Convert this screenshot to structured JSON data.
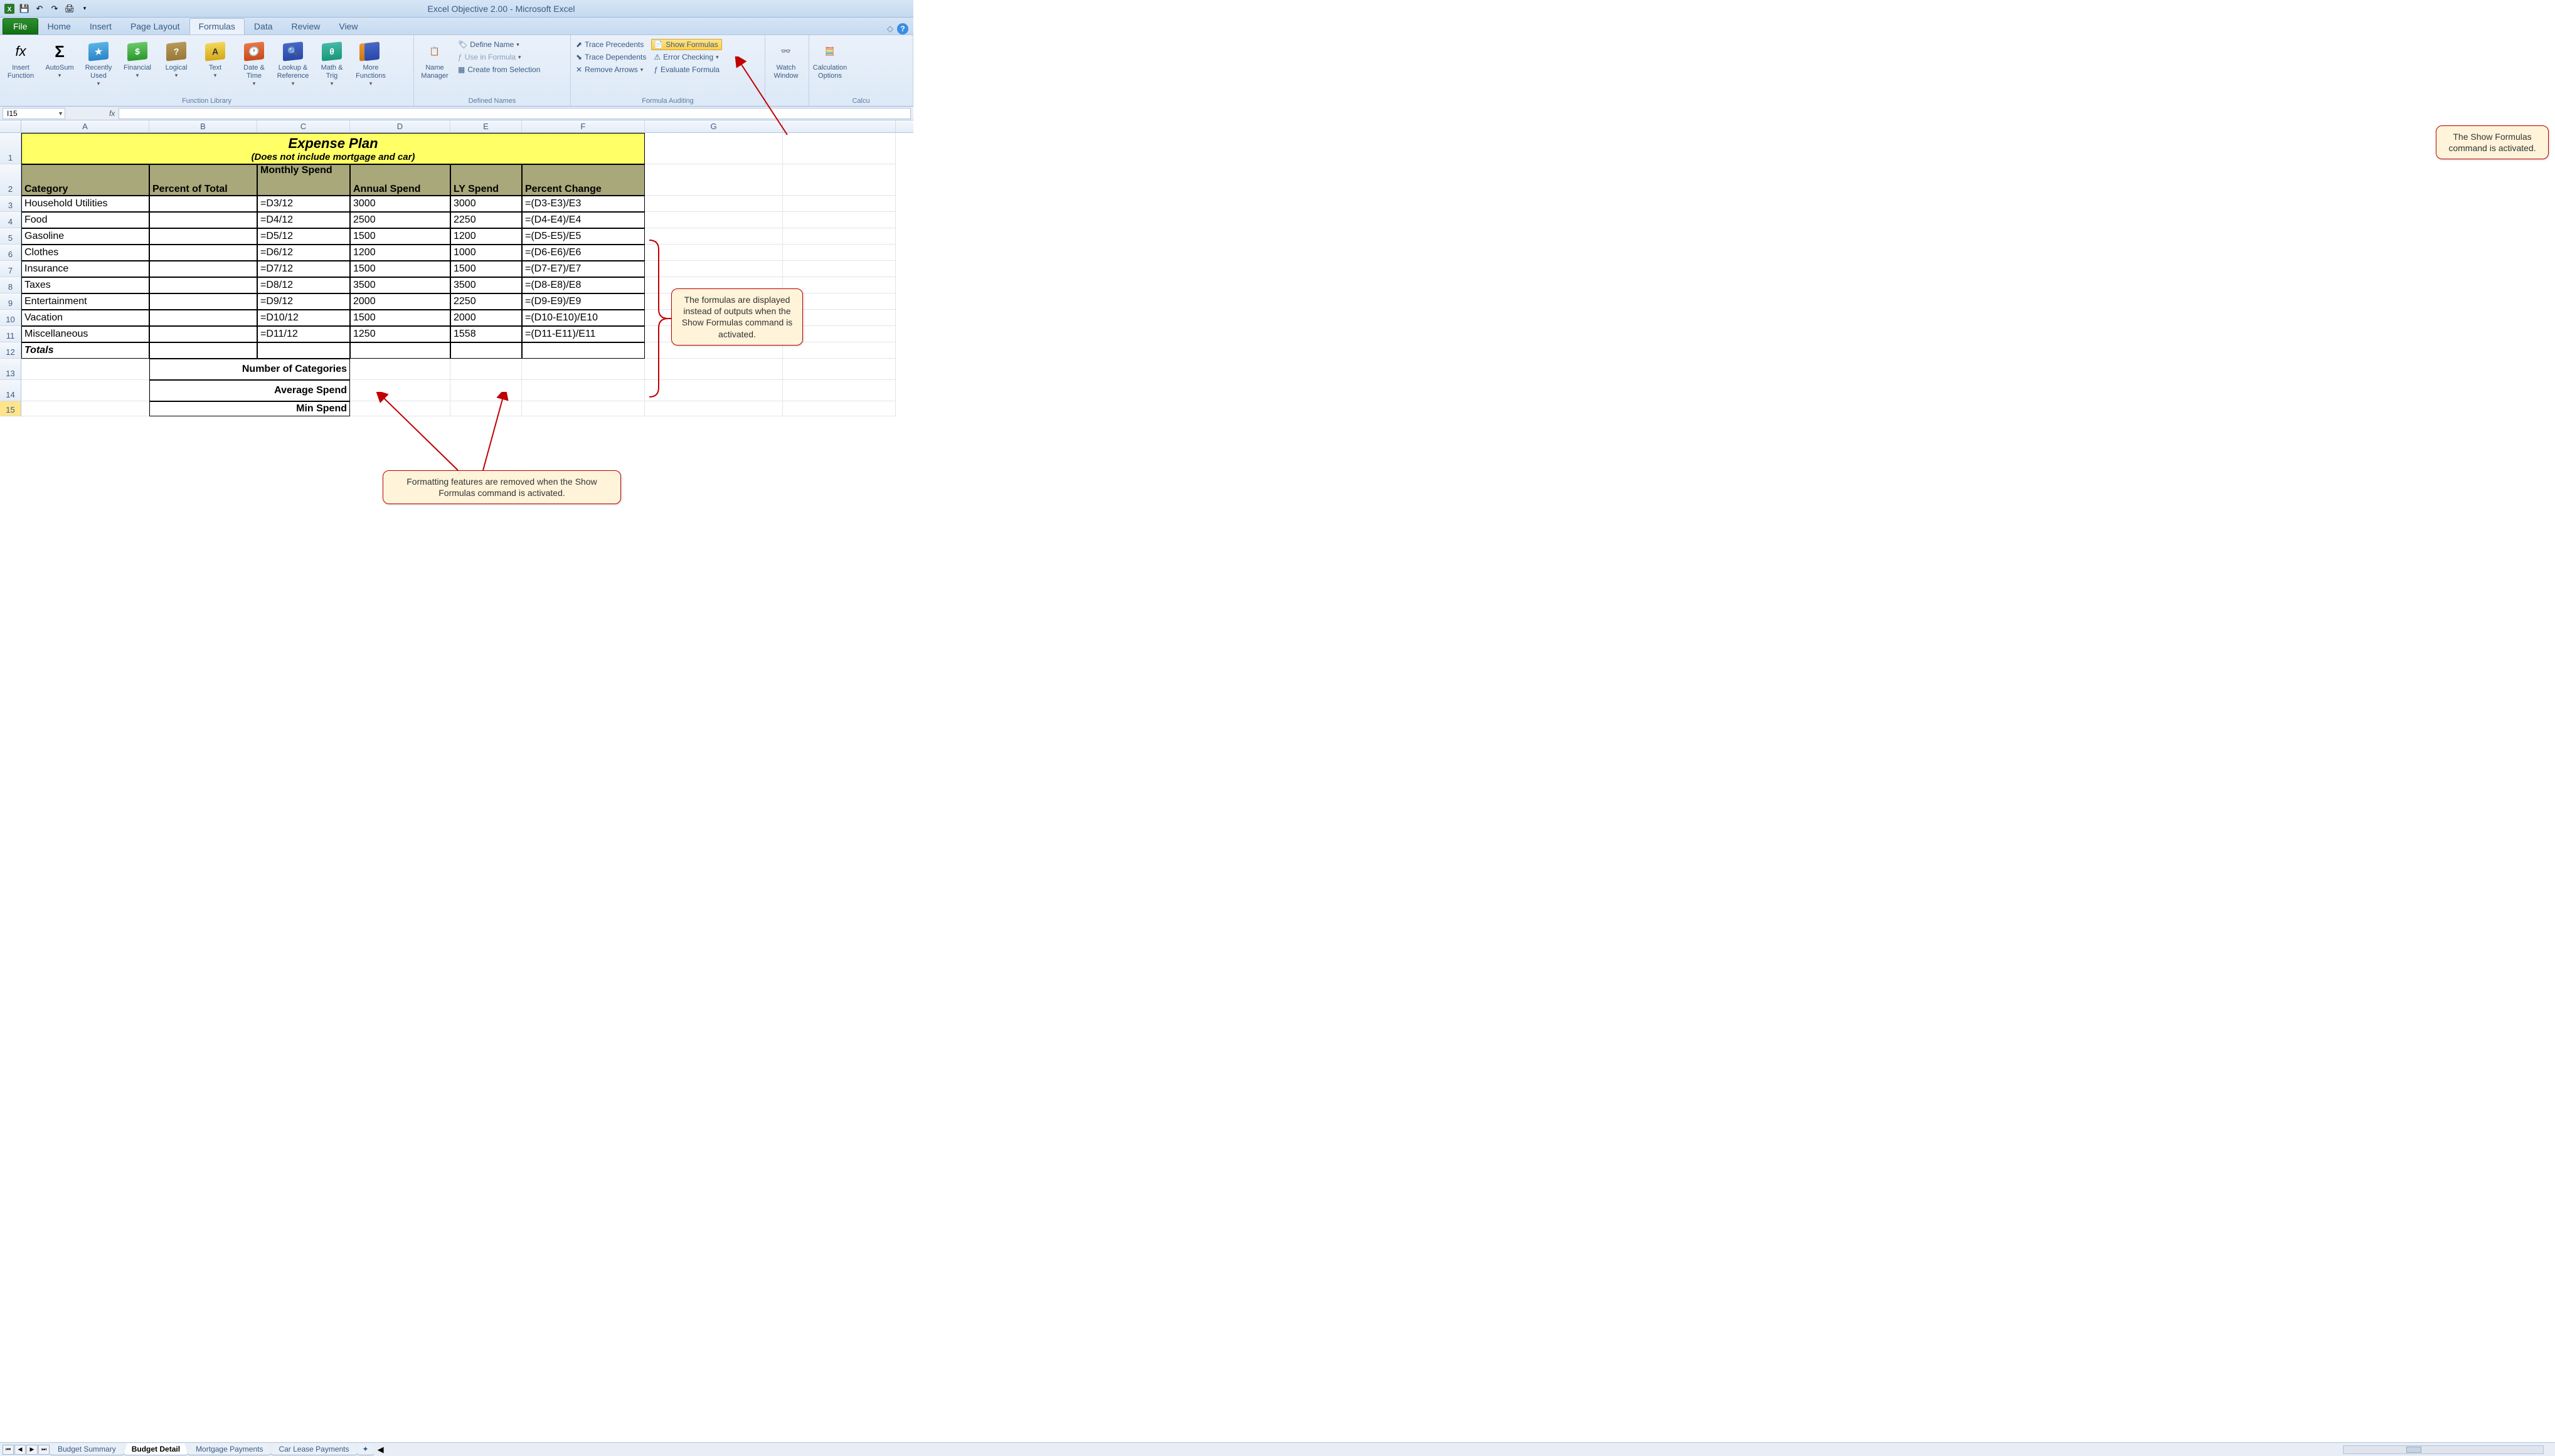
{
  "app": {
    "title_doc": "Excel Objective 2.00",
    "title_app": "Microsoft Excel"
  },
  "qat": {
    "save": "💾",
    "undo": "↶",
    "redo": "↷",
    "print": "🖨"
  },
  "tabs": [
    "File",
    "Home",
    "Insert",
    "Page Layout",
    "Formulas",
    "Data",
    "Review",
    "View"
  ],
  "active_tab": "Formulas",
  "ribbon": {
    "insert_function": "Insert Function",
    "autosum": "AutoSum",
    "recently_used": "Recently Used",
    "financial": "Financial",
    "logical": "Logical",
    "text": "Text",
    "date_time": "Date & Time",
    "lookup_ref": "Lookup & Reference",
    "math_trig": "Math & Trig",
    "more_functions": "More Functions",
    "group_function_library": "Function Library",
    "name_manager": "Name Manager",
    "define_name": "Define Name",
    "use_in_formula": "Use in Formula",
    "create_from_selection": "Create from Selection",
    "group_defined_names": "Defined Names",
    "trace_precedents": "Trace Precedents",
    "trace_dependents": "Trace Dependents",
    "remove_arrows": "Remove Arrows",
    "show_formulas": "Show Formulas",
    "error_checking": "Error Checking",
    "evaluate_formula": "Evaluate Formula",
    "group_formula_auditing": "Formula Auditing",
    "watch_window": "Watch Window",
    "calc_options": "Calculation Options",
    "group_calc": "Calcu"
  },
  "name_box": "I15",
  "fx_label": "fx",
  "columns": [
    "A",
    "B",
    "C",
    "D",
    "E",
    "F",
    "G"
  ],
  "sheet": {
    "title": "Expense Plan",
    "subtitle": "(Does not include mortgage and car)",
    "headers": {
      "category": "Category",
      "percent_of_total": "Percent of Total",
      "monthly_spend": "Monthly Spend",
      "annual_spend": "Annual Spend",
      "ly_spend": "LY Spend",
      "percent_change": "Percent Change"
    },
    "rows": [
      {
        "a": "Household Utilities",
        "b": "",
        "c": "=D3/12",
        "d": "3000",
        "e": "3000",
        "f": "=(D3-E3)/E3"
      },
      {
        "a": "Food",
        "b": "",
        "c": "=D4/12",
        "d": "2500",
        "e": "2250",
        "f": "=(D4-E4)/E4"
      },
      {
        "a": "Gasoline",
        "b": "",
        "c": "=D5/12",
        "d": "1500",
        "e": "1200",
        "f": "=(D5-E5)/E5"
      },
      {
        "a": "Clothes",
        "b": "",
        "c": "=D6/12",
        "d": "1200",
        "e": "1000",
        "f": "=(D6-E6)/E6"
      },
      {
        "a": "Insurance",
        "b": "",
        "c": "=D7/12",
        "d": "1500",
        "e": "1500",
        "f": "=(D7-E7)/E7"
      },
      {
        "a": "Taxes",
        "b": "",
        "c": "=D8/12",
        "d": "3500",
        "e": "3500",
        "f": "=(D8-E8)/E8"
      },
      {
        "a": "Entertainment",
        "b": "",
        "c": "=D9/12",
        "d": "2000",
        "e": "2250",
        "f": "=(D9-E9)/E9"
      },
      {
        "a": "Vacation",
        "b": "",
        "c": "=D10/12",
        "d": "1500",
        "e": "2000",
        "f": "=(D10-E10)/E10"
      },
      {
        "a": "Miscellaneous",
        "b": "",
        "c": "=D11/12",
        "d": "1250",
        "e": "1558",
        "f": "=(D11-E11)/E11"
      }
    ],
    "totals": "Totals",
    "num_categories": "Number of Categories",
    "avg_spend": "Average Spend",
    "min_spend": "Min Spend"
  },
  "sheet_tabs": [
    "Budget Summary",
    "Budget Detail",
    "Mortgage Payments",
    "Car Lease Payments"
  ],
  "active_sheet": "Budget Detail",
  "callouts": {
    "c1": "The Show Formulas command is activated.",
    "c2": "The formulas are displayed instead of outputs when the Show Formulas command is activated.",
    "c3": "Formatting features are removed when the Show Formulas command is activated."
  }
}
